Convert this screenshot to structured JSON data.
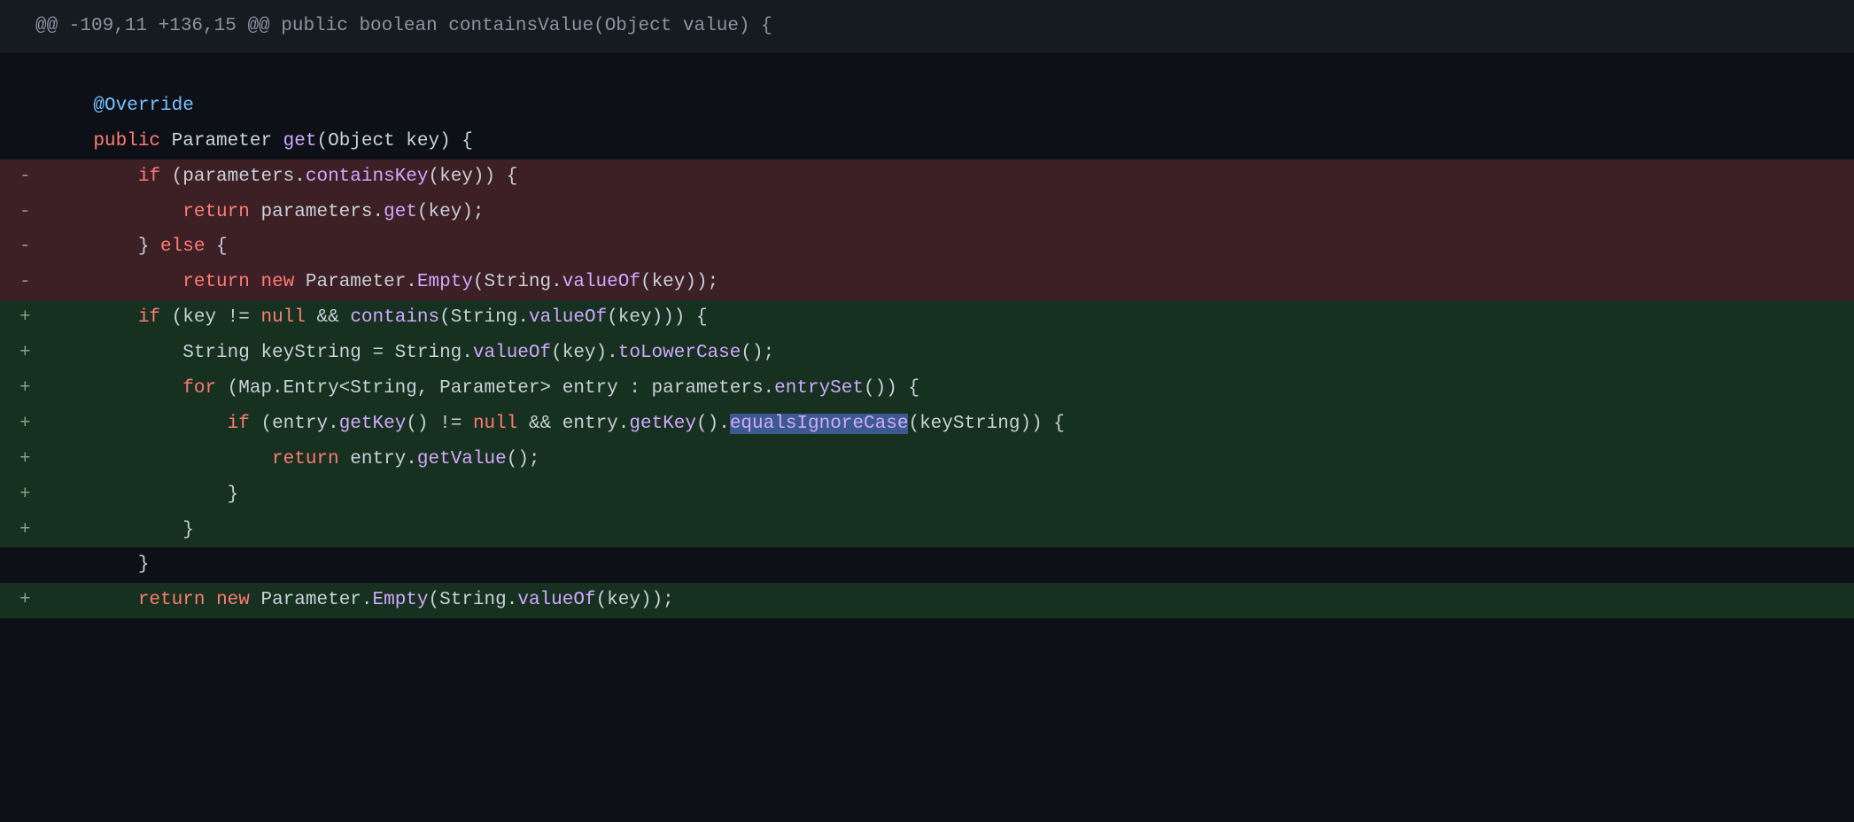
{
  "hunk_header": "@@ -109,11 +136,15 @@ public boolean containsValue(Object value) {",
  "lines": [
    {
      "type": "ctx",
      "marker": " ",
      "tokens": [
        {
          "cls": "t-plain",
          "txt": "    "
        },
        {
          "cls": "t-annot",
          "txt": "@Override"
        }
      ]
    },
    {
      "type": "ctx",
      "marker": " ",
      "tokens": [
        {
          "cls": "t-plain",
          "txt": "    "
        },
        {
          "cls": "t-kw",
          "txt": "public"
        },
        {
          "cls": "t-plain",
          "txt": " Parameter "
        },
        {
          "cls": "t-fn",
          "txt": "get"
        },
        {
          "cls": "t-plain",
          "txt": "(Object key) {"
        }
      ]
    },
    {
      "type": "del",
      "marker": "-",
      "tokens": [
        {
          "cls": "t-plain",
          "txt": "        "
        },
        {
          "cls": "t-kw",
          "txt": "if"
        },
        {
          "cls": "t-plain",
          "txt": " (parameters."
        },
        {
          "cls": "t-fn",
          "txt": "containsKey"
        },
        {
          "cls": "t-plain",
          "txt": "(key)) {"
        }
      ]
    },
    {
      "type": "del",
      "marker": "-",
      "tokens": [
        {
          "cls": "t-plain",
          "txt": "            "
        },
        {
          "cls": "t-kw",
          "txt": "return"
        },
        {
          "cls": "t-plain",
          "txt": " parameters."
        },
        {
          "cls": "t-fn",
          "txt": "get"
        },
        {
          "cls": "t-plain",
          "txt": "(key);"
        }
      ]
    },
    {
      "type": "del",
      "marker": "-",
      "tokens": [
        {
          "cls": "t-plain",
          "txt": "        } "
        },
        {
          "cls": "t-kw",
          "txt": "else"
        },
        {
          "cls": "t-plain",
          "txt": " {"
        }
      ]
    },
    {
      "type": "del",
      "marker": "-",
      "tokens": [
        {
          "cls": "t-plain",
          "txt": "            "
        },
        {
          "cls": "t-kw",
          "txt": "return"
        },
        {
          "cls": "t-plain",
          "txt": " "
        },
        {
          "cls": "t-kw",
          "txt": "new"
        },
        {
          "cls": "t-plain",
          "txt": " Parameter."
        },
        {
          "cls": "t-fn",
          "txt": "Empty"
        },
        {
          "cls": "t-plain",
          "txt": "(String."
        },
        {
          "cls": "t-fn",
          "txt": "valueOf"
        },
        {
          "cls": "t-plain",
          "txt": "(key));"
        }
      ]
    },
    {
      "type": "add",
      "marker": "+",
      "tokens": [
        {
          "cls": "t-plain",
          "txt": "        "
        },
        {
          "cls": "t-kw",
          "txt": "if"
        },
        {
          "cls": "t-plain",
          "txt": " (key != "
        },
        {
          "cls": "t-kw",
          "txt": "null"
        },
        {
          "cls": "t-plain",
          "txt": " && "
        },
        {
          "cls": "t-fn",
          "txt": "contains"
        },
        {
          "cls": "t-plain",
          "txt": "(String."
        },
        {
          "cls": "t-fn",
          "txt": "valueOf"
        },
        {
          "cls": "t-plain",
          "txt": "(key))) {"
        }
      ]
    },
    {
      "type": "add",
      "marker": "+",
      "tokens": [
        {
          "cls": "t-plain",
          "txt": "            String keyString = String."
        },
        {
          "cls": "t-fn",
          "txt": "valueOf"
        },
        {
          "cls": "t-plain",
          "txt": "(key)."
        },
        {
          "cls": "t-fn",
          "txt": "toLowerCase"
        },
        {
          "cls": "t-plain",
          "txt": "();"
        }
      ]
    },
    {
      "type": "add",
      "marker": "+",
      "tokens": [
        {
          "cls": "t-plain",
          "txt": "            "
        },
        {
          "cls": "t-kw",
          "txt": "for"
        },
        {
          "cls": "t-plain",
          "txt": " (Map.Entry<String, Parameter> entry : parameters."
        },
        {
          "cls": "t-fn",
          "txt": "entrySet"
        },
        {
          "cls": "t-plain",
          "txt": "()) {"
        }
      ]
    },
    {
      "type": "add",
      "marker": "+",
      "tokens": [
        {
          "cls": "t-plain",
          "txt": "                "
        },
        {
          "cls": "t-kw",
          "txt": "if"
        },
        {
          "cls": "t-plain",
          "txt": " (entry."
        },
        {
          "cls": "t-fn",
          "txt": "getKey"
        },
        {
          "cls": "t-plain",
          "txt": "() != "
        },
        {
          "cls": "t-kw",
          "txt": "null"
        },
        {
          "cls": "t-plain",
          "txt": " && entry."
        },
        {
          "cls": "t-fn",
          "txt": "getKey"
        },
        {
          "cls": "t-plain",
          "txt": "()."
        },
        {
          "cls": "t-hl",
          "txt": "equalsIgnoreCase"
        },
        {
          "cls": "t-plain",
          "txt": "(keyString)) {"
        }
      ]
    },
    {
      "type": "add",
      "marker": "+",
      "tokens": [
        {
          "cls": "t-plain",
          "txt": "                    "
        },
        {
          "cls": "t-kw",
          "txt": "return"
        },
        {
          "cls": "t-plain",
          "txt": " entry."
        },
        {
          "cls": "t-fn",
          "txt": "getValue"
        },
        {
          "cls": "t-plain",
          "txt": "();"
        }
      ]
    },
    {
      "type": "add",
      "marker": "+",
      "tokens": [
        {
          "cls": "t-plain",
          "txt": "                }"
        }
      ]
    },
    {
      "type": "add",
      "marker": "+",
      "tokens": [
        {
          "cls": "t-plain",
          "txt": "            }"
        }
      ]
    },
    {
      "type": "ctx",
      "marker": " ",
      "tokens": [
        {
          "cls": "t-plain",
          "txt": "        }"
        }
      ]
    },
    {
      "type": "add",
      "marker": "+",
      "tokens": [
        {
          "cls": "t-plain",
          "txt": "        "
        },
        {
          "cls": "t-kw",
          "txt": "return"
        },
        {
          "cls": "t-plain",
          "txt": " "
        },
        {
          "cls": "t-kw",
          "txt": "new"
        },
        {
          "cls": "t-plain",
          "txt": " Parameter."
        },
        {
          "cls": "t-fn",
          "txt": "Empty"
        },
        {
          "cls": "t-plain",
          "txt": "(String."
        },
        {
          "cls": "t-fn",
          "txt": "valueOf"
        },
        {
          "cls": "t-plain",
          "txt": "(key));"
        }
      ]
    }
  ]
}
